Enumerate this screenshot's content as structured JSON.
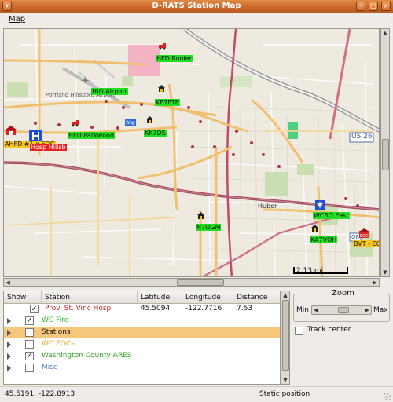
{
  "window": {
    "title": "D-RATS Station Map"
  },
  "menubar": {
    "map": "Map"
  },
  "map": {
    "places": {
      "portland_hills": "Portland Hillsboro Airport",
      "us26": "US 26",
      "huber": "Huber",
      "or": "OR"
    },
    "labels": {
      "hfd_ronler": "HFD Ronler",
      "hio_airport": "HIO Airport",
      "ke7fte": "KE7FTE",
      "me": "Me",
      "hfd_parkwood": "HFD Parkwood",
      "kk7ds": "KK7DS",
      "ahfd_eoc": "AHFD #1 o EOC",
      "hosp_hills": "Hosp Hillsb",
      "n7ogm": "N7OGM",
      "wc5o_east": "WC5O East",
      "ka7voh": "KA7VOH",
      "bvt_eoc": "BVT - EO"
    },
    "scale": "2.13 mi"
  },
  "station_list": {
    "columns": [
      "Show",
      "Station",
      "Latitude",
      "Longitude",
      "Distance"
    ],
    "rows": [
      {
        "station": "Prov. St. Vinc Hosp",
        "latitude": "45.5094",
        "longitude": "-122.7716",
        "distance": "7.53",
        "checked": true,
        "color": "#d02020",
        "child": true
      },
      {
        "station": "WC Fire",
        "checked": true,
        "color": "#22c022",
        "expander": "closed"
      },
      {
        "station": "Stations",
        "checked": false,
        "color": "#101010",
        "expander": "closed",
        "selected": true
      },
      {
        "station": "WC EOCs",
        "checked": false,
        "color": "#e8a020",
        "expander": "closed"
      },
      {
        "station": "Washington County ARES",
        "checked": true,
        "color": "#33aa22",
        "expander": "closed"
      },
      {
        "station": "Misc",
        "checked": false,
        "color": "#5577cc",
        "expander": "closed"
      }
    ]
  },
  "zoom": {
    "title": "Zoom",
    "min_label": "Min",
    "max_label": "Max",
    "level": 0.55
  },
  "track_center": {
    "label": "Track center",
    "checked": false
  },
  "status": {
    "coords": "45.5191, -122.8913",
    "mode": "Static position"
  }
}
